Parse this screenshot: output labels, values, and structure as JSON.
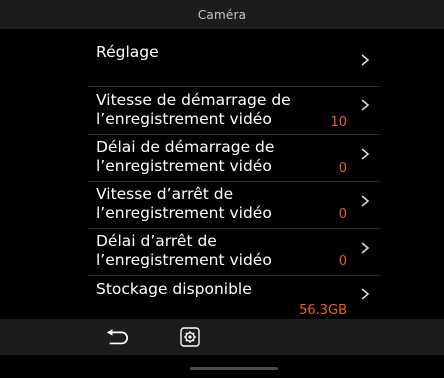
{
  "header": {
    "title": "Caméra"
  },
  "settings": {
    "items": [
      {
        "label": "Réglage",
        "value": ""
      },
      {
        "label": "Vitesse de démarrage de l’enregistrement vidéo",
        "value": "10"
      },
      {
        "label": "Délai de démarrage de l’enregistrement vidéo",
        "value": "0"
      },
      {
        "label": "Vitesse d’arrêt de l’enregistrement vidéo",
        "value": "0"
      },
      {
        "label": "Délai d’arrêt de l’enregistrement vidéo",
        "value": "0"
      },
      {
        "label": "Stockage disponible",
        "value": "56.3GB"
      }
    ]
  },
  "toolbar": {
    "back_icon": "back-arrow-icon",
    "settings_icon": "settings-gear-icon"
  },
  "colors": {
    "accent": "#e0612b",
    "background": "#000000",
    "bar": "#1c1c1c"
  }
}
